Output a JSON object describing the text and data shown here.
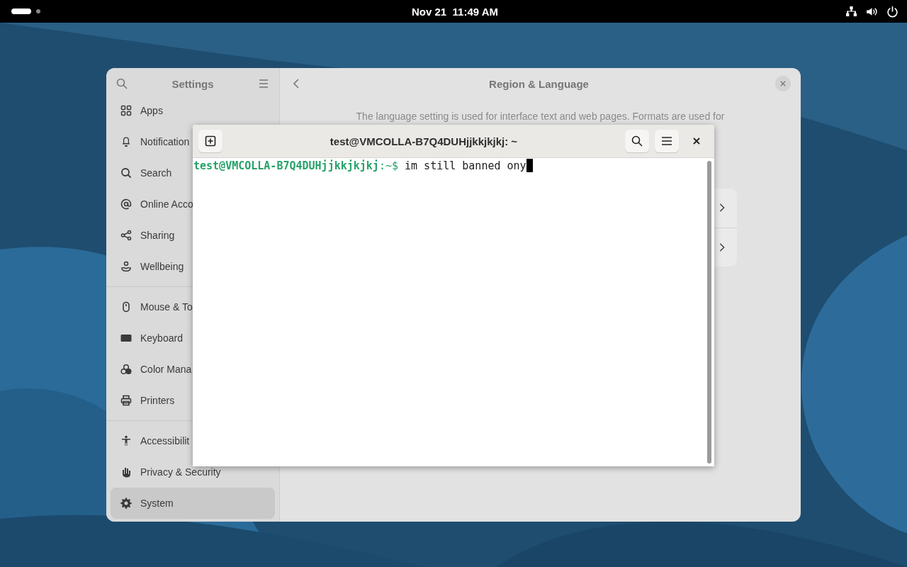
{
  "top_bar": {
    "clock": "Nov 21  11:49 AM"
  },
  "settings": {
    "title": "Settings",
    "sidebar_groups": [
      [
        {
          "label": "Apps",
          "selected": false
        },
        {
          "label": "Notification",
          "selected": false
        },
        {
          "label": "Search",
          "selected": false
        },
        {
          "label": "Online Acco",
          "selected": false
        },
        {
          "label": "Sharing",
          "selected": false
        },
        {
          "label": "Wellbeing",
          "selected": false
        }
      ],
      [
        {
          "label": "Mouse & To",
          "selected": false
        },
        {
          "label": "Keyboard",
          "selected": false
        },
        {
          "label": "Color Mana",
          "selected": false
        },
        {
          "label": "Printers",
          "selected": false
        }
      ],
      [
        {
          "label": "Accessibilit",
          "selected": false
        },
        {
          "label": "Privacy & Security",
          "selected": false
        },
        {
          "label": "System",
          "selected": true
        }
      ]
    ],
    "page_title": "Region & Language",
    "description": "The language setting is used for interface text and web pages. Formats are used for"
  },
  "terminal": {
    "title": "test@VMCOLLA-B7Q4DUHjjkkjkjkj: ~",
    "prompt_user": "test@VMCOLLA-B7Q4DUHjjkkjkjkj",
    "prompt_path": ":~$",
    "command": "im still banned ony"
  }
}
